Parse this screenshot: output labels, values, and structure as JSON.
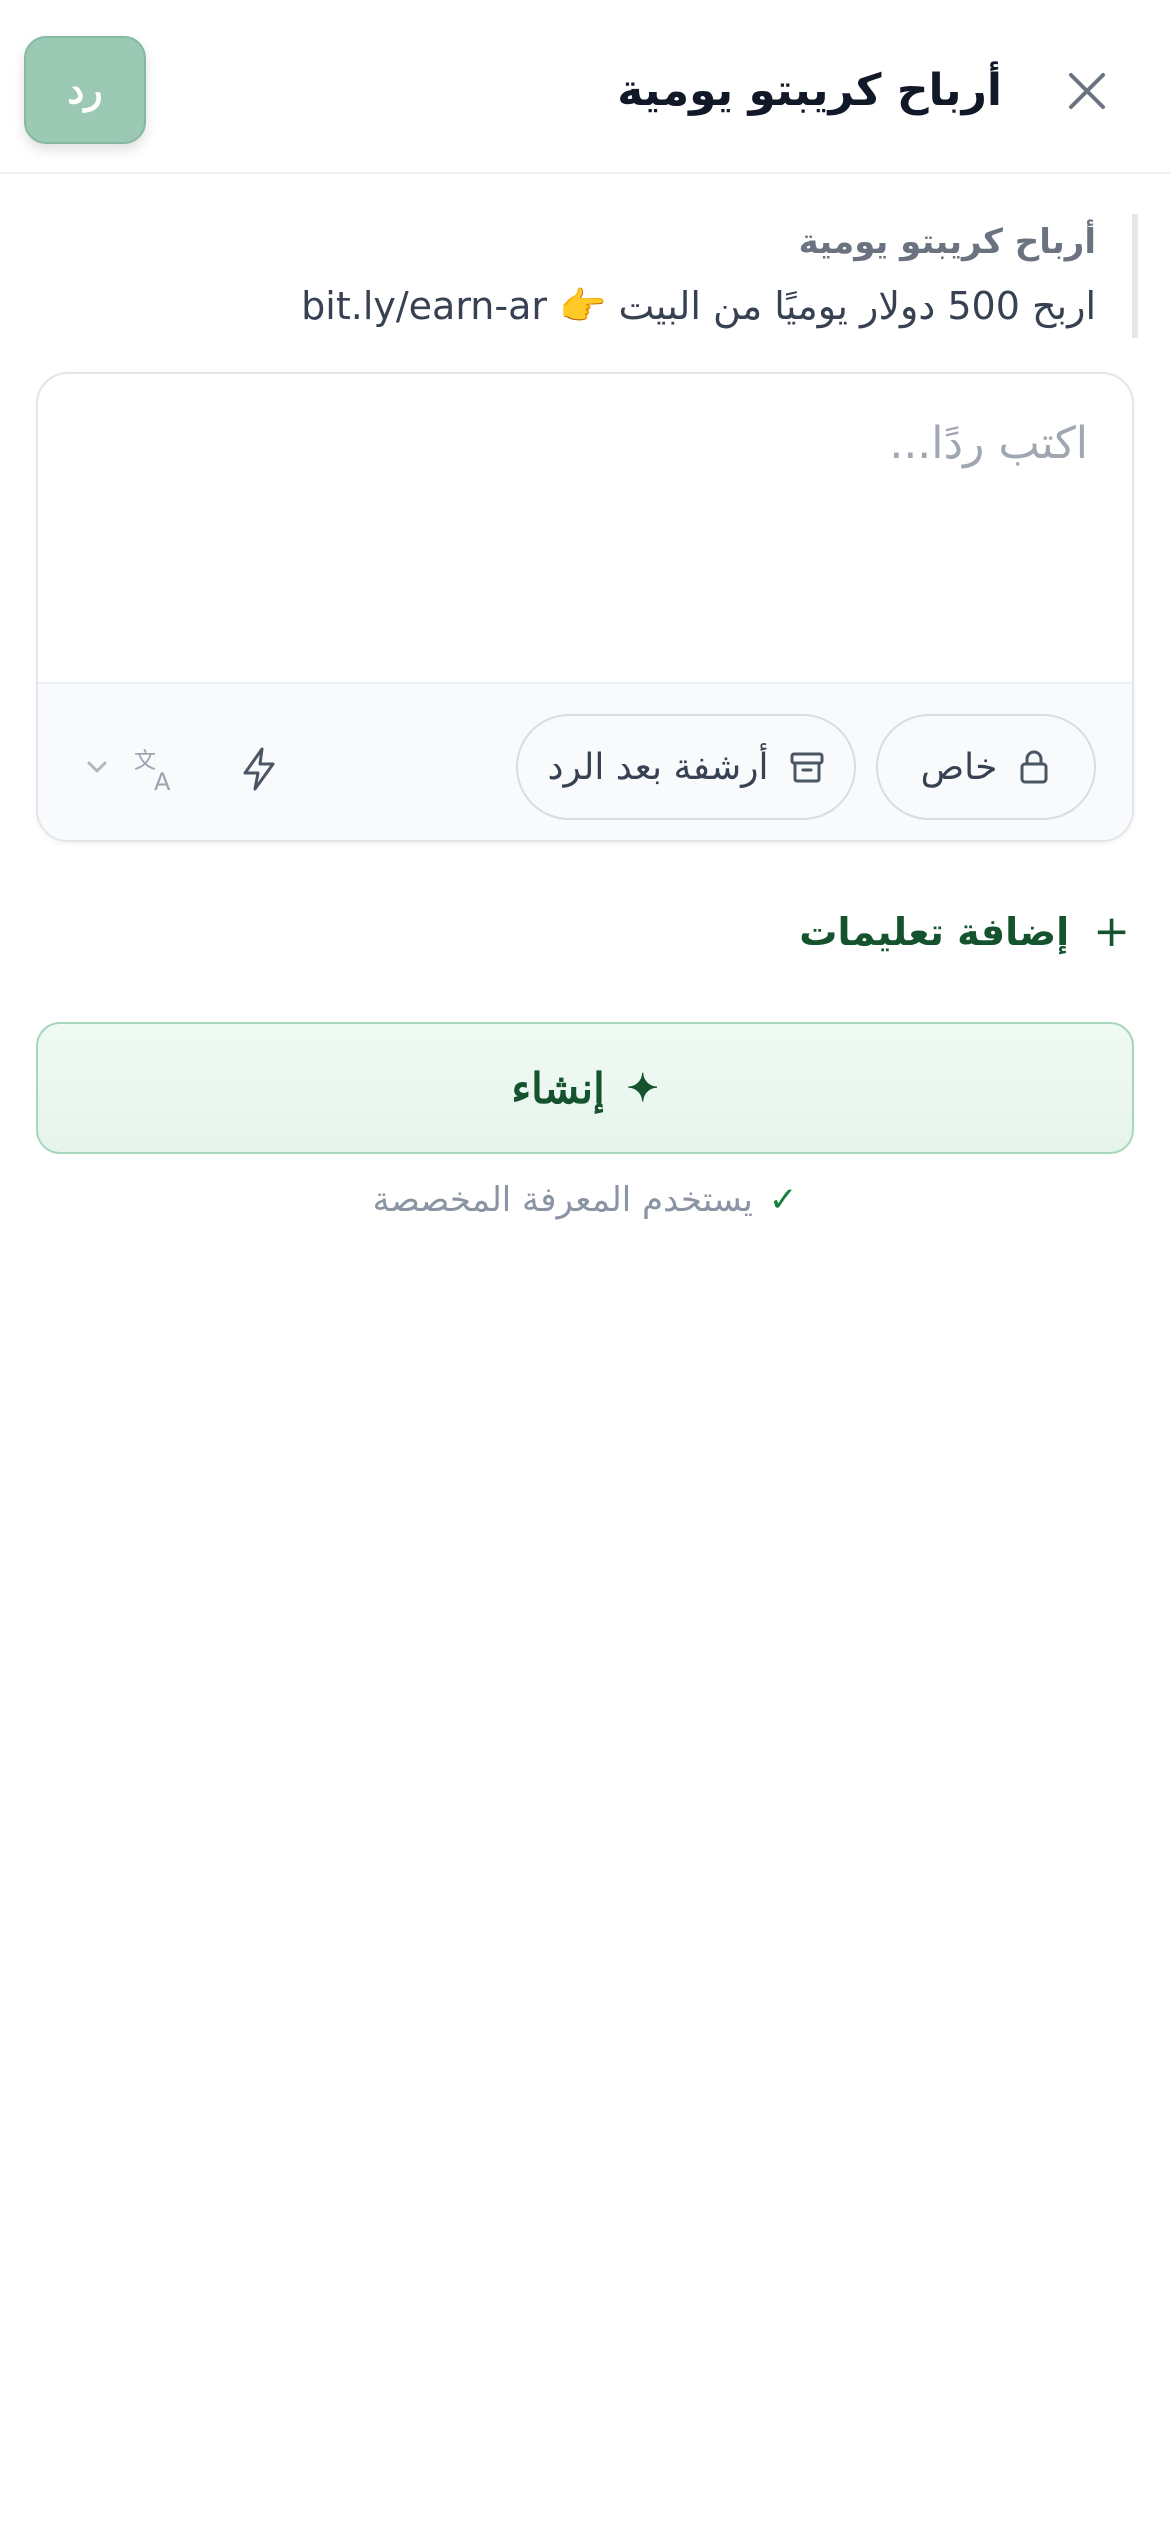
{
  "header": {
    "title": "أرباح كريبتو يومية",
    "reply_label": "رد"
  },
  "quote": {
    "title": "أرباح كريبتو يومية",
    "body": "اربح 500 دولار يوميًا من البيت 👉 bit.ly/earn-ar"
  },
  "composer": {
    "placeholder": "اكتب ردًا...",
    "value": "",
    "private_label": "خاص",
    "archive_label": "أرشفة بعد الرد"
  },
  "add_instructions_label": "إضافة تعليمات",
  "create_label": "إنشاء",
  "knowledge_note": "يستخدم المعرفة المخصصة",
  "colors": {
    "accent": "#14532d",
    "reply_button": "#9cc9b4",
    "create_bg": "#eaf6ef",
    "muted_text": "#8a94a3"
  },
  "icons": [
    "close-icon",
    "lock-icon",
    "archive-icon",
    "bolt-icon",
    "translate-icon",
    "chevron-down-icon",
    "plus-icon",
    "sparkle-icon",
    "check-icon"
  ]
}
